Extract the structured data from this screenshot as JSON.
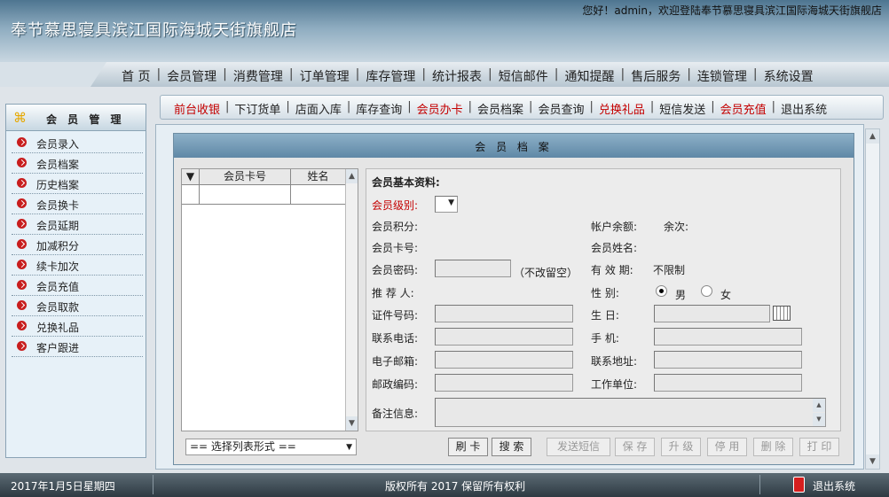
{
  "header": {
    "shop_title": "奉节慕思寝具滨江国际海城天街旗舰店",
    "welcome": "您好！admin，欢迎登陆奉节慕思寝具滨江国际海城天街旗舰店"
  },
  "mainnav": {
    "items": [
      "首 页",
      "会员管理",
      "消费管理",
      "订单管理",
      "库存管理",
      "统计报表",
      "短信邮件",
      "通知提醒",
      "售后服务",
      "连锁管理",
      "系统设置"
    ]
  },
  "sidebar": {
    "title": "会 员 管 理",
    "items": [
      "会员录入",
      "会员档案",
      "历史档案",
      "会员换卡",
      "会员延期",
      "加减积分",
      "续卡加次",
      "会员充值",
      "会员取款",
      "兑换礼品",
      "客户跟进"
    ]
  },
  "subnav": {
    "items": [
      {
        "label": "前台收银",
        "red": true
      },
      {
        "label": "下订货单",
        "red": false
      },
      {
        "label": "店面入库",
        "red": false
      },
      {
        "label": "库存查询",
        "red": false
      },
      {
        "label": "会员办卡",
        "red": true
      },
      {
        "label": "会员档案",
        "red": false
      },
      {
        "label": "会员查询",
        "red": false
      },
      {
        "label": "兑换礼品",
        "red": true
      },
      {
        "label": "短信发送",
        "red": false
      },
      {
        "label": "会员充值",
        "red": true
      },
      {
        "label": "退出系统",
        "red": false
      }
    ]
  },
  "panel": {
    "title": "会 员 档 案",
    "list": {
      "sort_icon": "▼",
      "col_card": "会员卡号",
      "col_name": "姓名"
    },
    "basic": {
      "heading": "会员基本资料:",
      "level_label": "会员级别:",
      "points_label": "会员积分:",
      "balance_label": "帐户余额:",
      "remaining_label": "余次:",
      "cardno_label": "会员卡号:",
      "membername_label": "会员姓名:",
      "password_label": "会员密码:",
      "password_hint": "（不改留空）",
      "validity_label": "有 效 期:",
      "validity_value": "不限制",
      "referrer_label": "推 荐 人:",
      "gender_label": "性    别:",
      "gender_male": "男",
      "gender_female": "女",
      "id_label": "证件号码:",
      "birthday_label": "生    日:",
      "phone_label": "联系电话:",
      "mobile_label": "手    机:",
      "email_label": "电子邮箱:",
      "address_label": "联系地址:",
      "zip_label": "邮政编码:",
      "work_label": "工作单位:",
      "remark_label": "备注信息:"
    },
    "select_list": "== 选择列表形式 ==",
    "buttons": {
      "swipe": "刷 卡",
      "search": "搜 索",
      "sms": "发送短信",
      "save": "保 存",
      "upgrade": "升 级",
      "disable": "停 用",
      "delete": "删 除",
      "print": "打 印"
    }
  },
  "status": {
    "date": "2017年1月5日星期四",
    "copyright": "版权所有 2017 保留所有权利",
    "exit": "退出系统"
  },
  "colors": {
    "red_link": "#c40000",
    "header_blue": "#4e7590"
  }
}
